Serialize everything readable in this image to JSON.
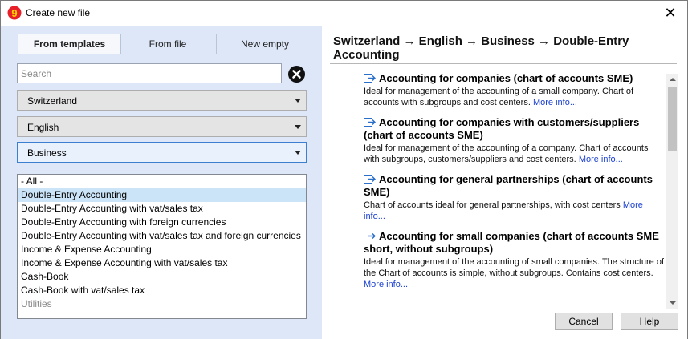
{
  "window": {
    "title": "Create new file",
    "close_glyph": "✕",
    "app_icon": "banana-logo-icon"
  },
  "tabs": [
    {
      "label": "From templates",
      "active": true
    },
    {
      "label": "From file",
      "active": false
    },
    {
      "label": "New empty",
      "active": false
    }
  ],
  "search": {
    "placeholder": "Search",
    "value": "",
    "clear_icon": "clear-circle-x-icon"
  },
  "filters": {
    "country": "Switzerland",
    "language": "English",
    "category": "Business"
  },
  "template_types": [
    {
      "label": "- All -",
      "selected": false
    },
    {
      "label": "Double-Entry Accounting",
      "selected": true
    },
    {
      "label": "Double-Entry Accounting with vat/sales tax",
      "selected": false
    },
    {
      "label": "Double-Entry Accounting with foreign currencies",
      "selected": false
    },
    {
      "label": "Double-Entry Accounting with vat/sales tax and foreign currencies",
      "selected": false
    },
    {
      "label": "Income & Expense Accounting",
      "selected": false
    },
    {
      "label": "Income & Expense Accounting with vat/sales tax",
      "selected": false
    },
    {
      "label": "Cash-Book",
      "selected": false
    },
    {
      "label": "Cash-Book with vat/sales tax",
      "selected": false
    },
    {
      "label": "Utilities",
      "selected": false
    }
  ],
  "breadcrumb": "Switzerland → English → Business → Double-Entry Accounting",
  "results": [
    {
      "title": "Accounting for companies (chart of accounts SME)",
      "description": "Ideal for management of the accounting of a small company. Chart of accounts with subgroups and cost centers.",
      "more_label": "More info..."
    },
    {
      "title": "Accounting for companies with customers/suppliers (chart of accounts SME)",
      "description": "Ideal for management of the accounting of a company. Chart of accounts with subgroups, customers/suppliers and cost centers.",
      "more_label": "More info..."
    },
    {
      "title": "Accounting for general partnerships (chart of accounts SME)",
      "description": "Chart of accounts ideal for general partnerships, with cost centers",
      "more_label": "More info..."
    },
    {
      "title": "Accounting for small companies (chart of accounts SME short, without subgroups)",
      "description": "Ideal for management of the accounting of small companies. The structure of the Chart of accounts is simple, without subgroups. Contains cost centers.",
      "more_label": "More info..."
    }
  ],
  "result_icon": "open-template-arrow-icon",
  "buttons": {
    "cancel": "Cancel",
    "help": "Help"
  },
  "colors": {
    "left_panel_bg": "#dde7f8",
    "selected_row": "#cce4f7",
    "link": "#1a3fd1",
    "focus_border": "#3c7fd1"
  }
}
